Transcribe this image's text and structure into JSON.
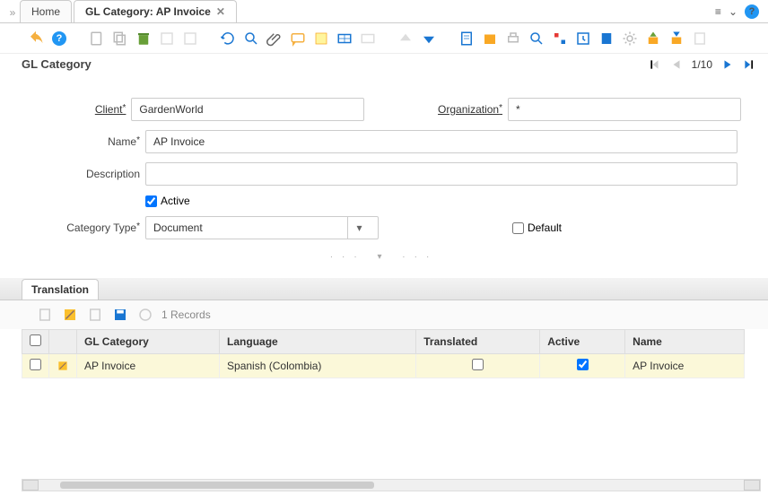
{
  "tabs": {
    "home": "Home",
    "activeTitle": "GL Category: AP Invoice"
  },
  "title": "GL Category",
  "nav": {
    "count": "1/10"
  },
  "fields": {
    "clientLabel": "Client",
    "clientValue": "GardenWorld",
    "orgLabel": "Organization",
    "orgValue": "*",
    "nameLabel": "Name",
    "nameValue": "AP Invoice",
    "descLabel": "Description",
    "descValue": "",
    "activeLabel": "Active",
    "categoryTypeLabel": "Category Type",
    "categoryTypeValue": "Document",
    "defaultLabel": "Default"
  },
  "subtab": {
    "label": "Translation",
    "records": "1 Records"
  },
  "table": {
    "headers": {
      "glCategory": "GL Category",
      "language": "Language",
      "translated": "Translated",
      "active": "Active",
      "name": "Name"
    },
    "row": {
      "glCategory": "AP Invoice",
      "language": "Spanish (Colombia)",
      "name": "AP Invoice"
    }
  }
}
